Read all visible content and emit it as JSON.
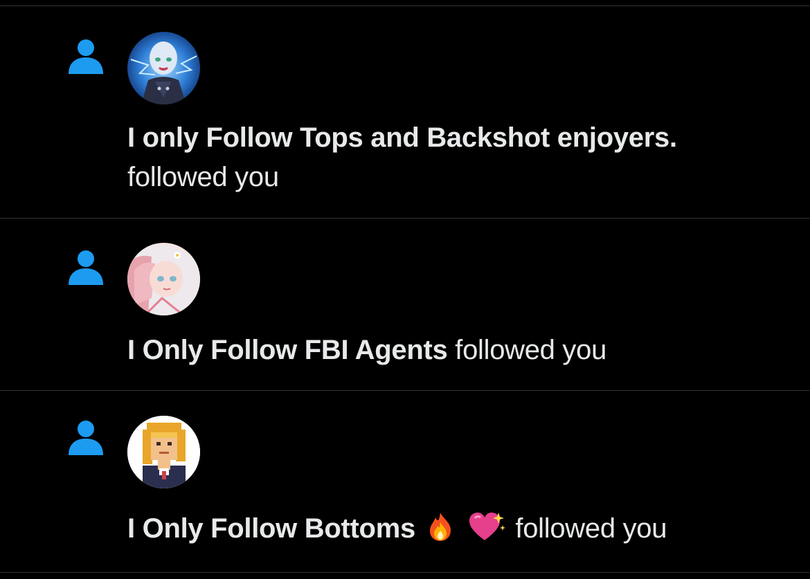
{
  "theme": {
    "background": "#000000",
    "divider": "#2f3336",
    "accent": "#1d9bf0",
    "text": "#e7e9ea"
  },
  "notifications": [
    {
      "icon": "person-icon",
      "name": "I only Follow Tops and Backshot enjoyers.",
      "action": "followed you",
      "avatar": "anime-character-blue-lightning-avatar"
    },
    {
      "icon": "person-icon",
      "name": "I Only Follow FBI Agents",
      "action": "followed you",
      "avatar": "anime-girl-pink-white-hair-avatar"
    },
    {
      "icon": "person-icon",
      "name": "I Only Follow Bottoms",
      "emojis": [
        "fire-emoji",
        "sparkling-heart-emoji"
      ],
      "action": "followed you",
      "avatar": "pixel-art-blonde-man-avatar"
    }
  ]
}
